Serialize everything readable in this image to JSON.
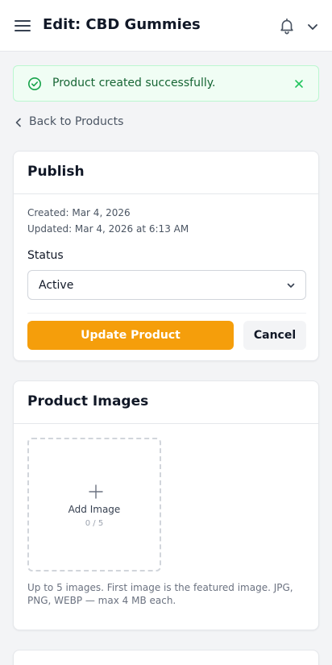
{
  "header": {
    "title": "Edit: CBD Gummies",
    "menu_icon": "hamburger-menu-icon",
    "bell_icon": "bell-icon",
    "dropdown_icon": "chevron-down-icon"
  },
  "alert": {
    "message": "Product created successfully.",
    "icon": "check-circle-icon",
    "close_icon": "close-icon",
    "color": "#166534"
  },
  "nav": {
    "back_label": "Back to Products"
  },
  "publish": {
    "title": "Publish",
    "created": "Created: Mar 4, 2026",
    "updated": "Updated: Mar 4, 2026 at 6:13 AM",
    "status_label": "Status",
    "status_value": "Active",
    "update_button": "Update Product",
    "cancel_button": "Cancel",
    "accent_color": "#f59e0b"
  },
  "images": {
    "title": "Product Images",
    "add_label": "Add Image",
    "count": "0 / 5",
    "help": "Up to 5 images. First image is the featured image. JPG, PNG, WEBP — max 4 MB each."
  }
}
